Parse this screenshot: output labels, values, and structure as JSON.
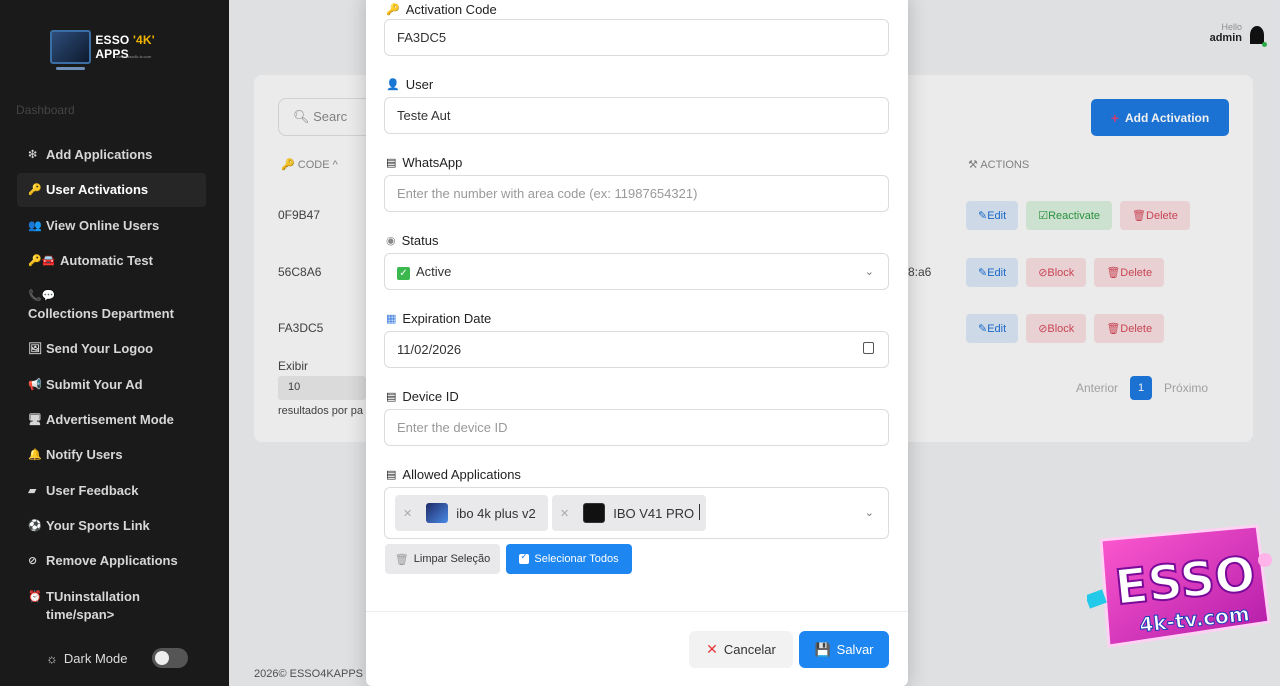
{
  "sidebar": {
    "logo": {
      "title_a": "ESSO ",
      "title_b": "'4K'",
      "title_c": " APPS",
      "subtitle": "www.esso4k-tv.com"
    },
    "dashboard": "Dashboard",
    "items": [
      {
        "icon": "❇",
        "label": "Add Applications",
        "active": false
      },
      {
        "icon": "🔑",
        "label": "User Activations",
        "active": true
      },
      {
        "icon": "👥",
        "label": "View Online Users",
        "active": false
      },
      {
        "icon": "🔑🚘",
        "label": "Automatic Test",
        "active": false
      },
      {
        "icon": "📞💬",
        "label": "Collections Department",
        "active": false
      },
      {
        "icon": "🖼",
        "label": "Send Your Logoo",
        "active": false
      },
      {
        "icon": "📢",
        "label": "Submit Your Ad",
        "active": false
      },
      {
        "icon": "🖥",
        "label": "Advertisement Mode",
        "active": false
      },
      {
        "icon": "🔔",
        "label": "Notify Users",
        "active": false
      },
      {
        "icon": "▰",
        "label": "User Feedback",
        "active": false
      },
      {
        "icon": "⚽",
        "label": "Your Sports Link",
        "active": false
      },
      {
        "icon": "⊘",
        "label": "Remove Applications",
        "active": false
      },
      {
        "icon": "⏰",
        "label": "TUninstallation time/span>",
        "active": false
      }
    ],
    "dark_mode": "Dark Mode"
  },
  "header": {
    "hello": "Hello",
    "user": "admin"
  },
  "table": {
    "search_placeholder": "Searc",
    "add_button": "Add Activation",
    "col_code": "CODE ^",
    "col_actions": "ACTIONS",
    "rows": [
      {
        "code": "0F9B47",
        "actions": [
          "Edit",
          "Reactivate",
          "Delete"
        ]
      },
      {
        "code": "56C8A6",
        "mac_fragment": "8:a6",
        "actions": [
          "Edit",
          "Block",
          "Delete"
        ]
      },
      {
        "code": "FA3DC5",
        "actions": [
          "Edit",
          "Block",
          "Delete"
        ]
      }
    ],
    "exibir": "Exibir",
    "page_size": "10",
    "results_per_page": "resultados por pa",
    "prev": "Anterior",
    "page": "1",
    "next": "Próximo"
  },
  "footer": "2026© ESSO4KAPPS",
  "modal": {
    "activation_code_label": "Activation Code",
    "activation_code": "FA3DC5",
    "user_label": "User",
    "user": "Teste Aut",
    "whatsapp_label": "WhatsApp",
    "whatsapp_placeholder": "Enter the number with area code (ex: 11987654321)",
    "status_label": "Status",
    "status": "Active",
    "expiration_label": "Expiration Date",
    "expiration": "11/02/2026",
    "device_label": "Device ID",
    "device_placeholder": "Enter the device ID",
    "apps_label": "Allowed Applications",
    "apps": [
      "ibo 4k plus v2",
      "IBO V41 PRO"
    ],
    "clear_btn": "Limpar Seleção",
    "select_all_btn": "Selecionar Todos",
    "cancel_btn": "Cancelar",
    "save_btn": "Salvar"
  },
  "badge": {
    "line1": "ESSO",
    "line2": "4k-tv.com"
  }
}
